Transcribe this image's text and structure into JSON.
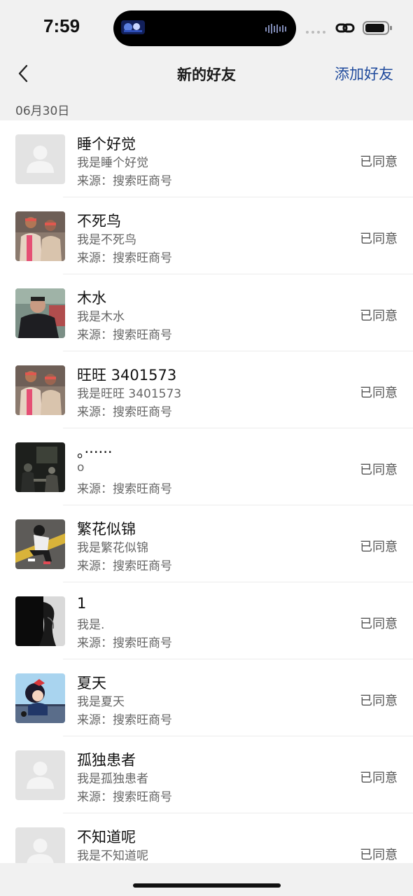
{
  "status_bar": {
    "time": "7:59"
  },
  "nav": {
    "title": "新的好友",
    "add_label": "添加好友"
  },
  "date_header": "06月30日",
  "friends": [
    {
      "name": "睡个好觉",
      "message": "我是睡个好觉",
      "source": "来源：搜索旺商号",
      "status": "已同意",
      "avatar": "default-avatar"
    },
    {
      "name": "不死鸟",
      "message": "我是不死鸟",
      "source": "来源：搜索旺商号",
      "status": "已同意",
      "avatar": "couple-photo-avatar"
    },
    {
      "name": "木水",
      "message": "我是木水",
      "source": "来源：搜索旺商号",
      "status": "已同意",
      "avatar": "person-black-coat-avatar"
    },
    {
      "name": "旺旺 3401573",
      "message": "我是旺旺 3401573",
      "source": "来源：搜索旺商号",
      "status": "已同意",
      "avatar": "couple-photo-avatar"
    },
    {
      "name": "。······",
      "message": "o",
      "source": "来源：搜索旺商号",
      "status": "已同意",
      "avatar": "dark-room-avatar"
    },
    {
      "name": "繁花似锦",
      "message": "我是繁花似锦",
      "source": "来源：搜索旺商号",
      "status": "已同意",
      "avatar": "sitting-person-avatar"
    },
    {
      "name": "1",
      "message": "我是.",
      "source": "来源：搜索旺商号",
      "status": "已同意",
      "avatar": "dark-silhouette-avatar"
    },
    {
      "name": "夏天",
      "message": "我是夏天",
      "source": "来源：搜索旺商号",
      "status": "已同意",
      "avatar": "anime-girl-avatar"
    },
    {
      "name": "孤独患者",
      "message": "我是孤独患者",
      "source": "来源：搜索旺商号",
      "status": "已同意",
      "avatar": "default-avatar"
    },
    {
      "name": "不知道呢",
      "message": "我是不知道呢",
      "source": "",
      "status": "已同意",
      "avatar": "default-avatar"
    }
  ],
  "colors": {
    "accent": "#1f4a9c",
    "page_bg": "#f1f1f1"
  }
}
